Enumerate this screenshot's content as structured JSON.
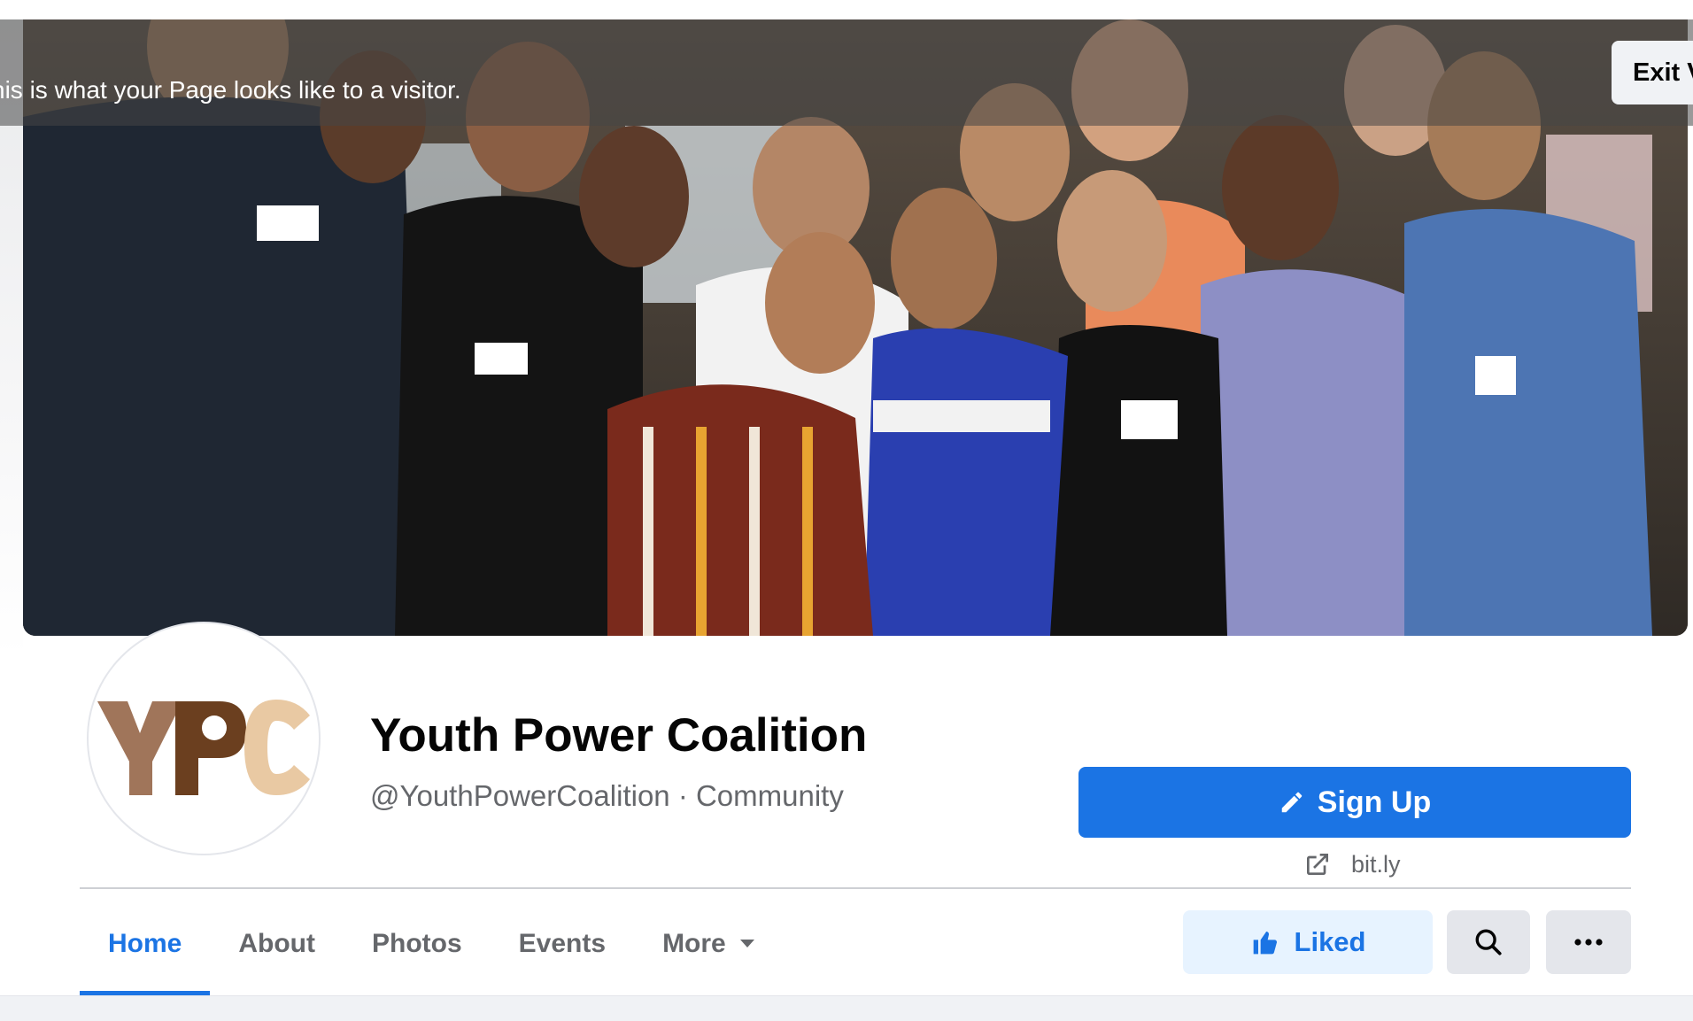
{
  "visitor_banner": {
    "text": "his is what your Page looks like to a visitor.",
    "exit_label": "Exit V"
  },
  "cover": {
    "description_icon": "cover-photo-group"
  },
  "profile": {
    "logo_text": "YPC",
    "name": "Youth Power Coalition",
    "subtitle": "@YouthPowerCoalition · Community"
  },
  "actions": {
    "signup_label": "Sign Up",
    "link_text": "bit.ly",
    "liked_label": "Liked",
    "search_icon": "search-icon",
    "more_icon": "ellipsis-icon"
  },
  "tabs": [
    {
      "label": "Home",
      "active": true
    },
    {
      "label": "About",
      "active": false
    },
    {
      "label": "Photos",
      "active": false
    },
    {
      "label": "Events",
      "active": false
    },
    {
      "label": "More",
      "active": false
    }
  ],
  "colors": {
    "accent": "#1b74e4",
    "liked_bg": "#e7f3ff",
    "logo_dark": "#6b3f1f",
    "logo_mid": "#a0755a",
    "logo_light": "#e9c9a3"
  }
}
